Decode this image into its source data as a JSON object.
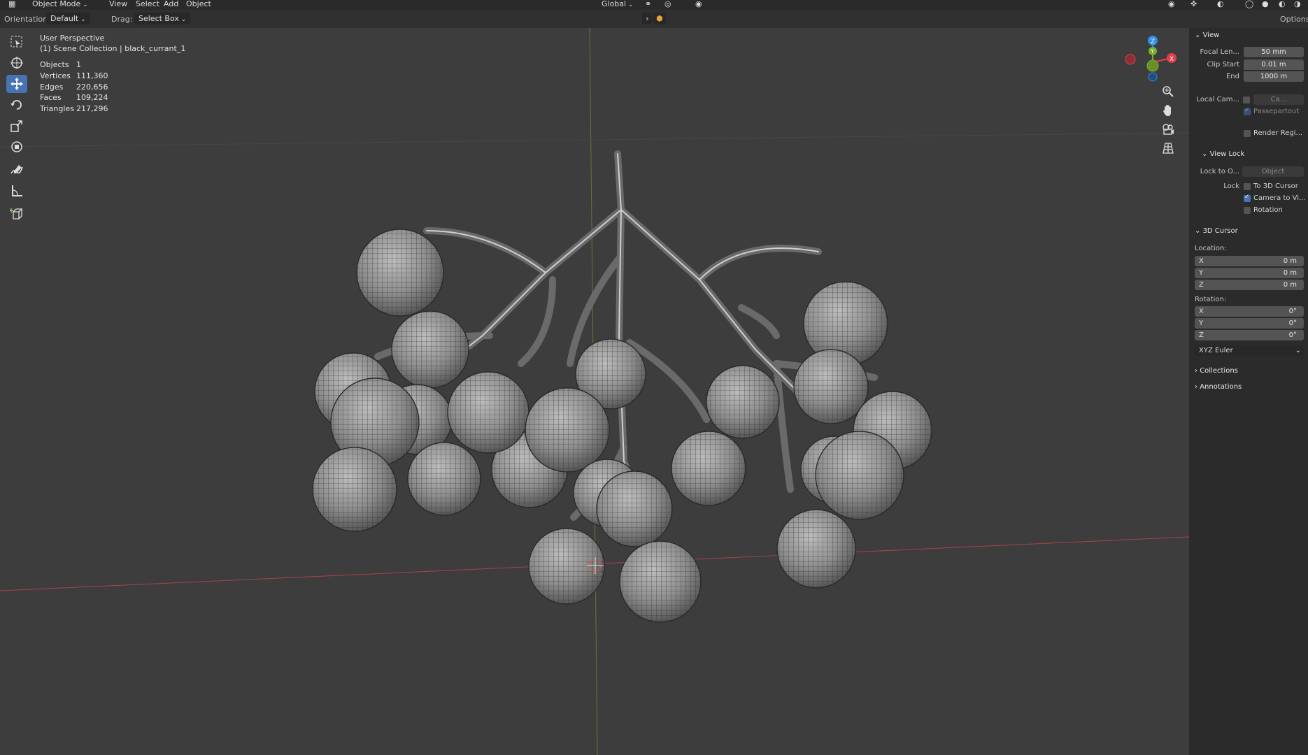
{
  "topbar": {
    "mode": "Object Mode",
    "menus": [
      "View",
      "Select",
      "Add",
      "Object"
    ],
    "transform_space": "Global"
  },
  "header": {
    "orientation_label": "Orientation:",
    "orientation_value": "Default",
    "drag_label": "Drag:",
    "drag_value": "Select Box",
    "options_label": "Options"
  },
  "overlay": {
    "view_name": "User Perspective",
    "collection": "(1) Scene Collection | black_currant_1",
    "stats": [
      {
        "label": "Objects",
        "value": "1"
      },
      {
        "label": "Vertices",
        "value": "111,360"
      },
      {
        "label": "Edges",
        "value": "220,656"
      },
      {
        "label": "Faces",
        "value": "109,224"
      },
      {
        "label": "Triangles",
        "value": "217,296"
      }
    ]
  },
  "gizmo": {
    "x": "X",
    "y": "Y",
    "z": "Z"
  },
  "npanel": {
    "view_section": "View",
    "focal_label": "Focal Len...",
    "focal_value": "50 mm",
    "clip_start_label": "Clip Start",
    "clip_start_value": "0.01 m",
    "end_label": "End",
    "end_value": "1000 m",
    "local_cam_label": "Local Cam...",
    "local_cam_value": "Ca...",
    "passepartout": "Passepartout",
    "render_region": "Render Regi...",
    "view_lock_section": "View Lock",
    "lock_to_label": "Lock to O...",
    "lock_to_placeholder": "Object",
    "lock_label": "Lock",
    "lock_3d_cursor": "To 3D Cursor",
    "lock_camera": "Camera to Vi...",
    "lock_rotation": "Rotation",
    "cursor_section": "3D Cursor",
    "location_label": "Location:",
    "location": [
      {
        "axis": "X",
        "value": "0 m"
      },
      {
        "axis": "Y",
        "value": "0 m"
      },
      {
        "axis": "Z",
        "value": "0 m"
      }
    ],
    "rotation_label": "Rotation:",
    "rotation": [
      {
        "axis": "X",
        "value": "0°"
      },
      {
        "axis": "Y",
        "value": "0°"
      },
      {
        "axis": "Z",
        "value": "0°"
      }
    ],
    "rotation_mode": "XYZ Euler",
    "collections_section": "Collections",
    "annotations_section": "Annotations"
  },
  "colors": {
    "accent": "#4772b3",
    "axis_x": "#e0404a",
    "axis_y": "#7ab02e",
    "axis_z": "#2f8ee8",
    "viewport_bg": "#3d3d3d"
  },
  "icons": [
    "select-box-icon",
    "cursor-icon",
    "move-icon",
    "rotate-icon",
    "scale-icon",
    "transform-icon",
    "annotate-icon",
    "measure-icon",
    "add-cube-icon",
    "zoom-icon",
    "hand-icon",
    "camera-icon",
    "grid-icon"
  ]
}
